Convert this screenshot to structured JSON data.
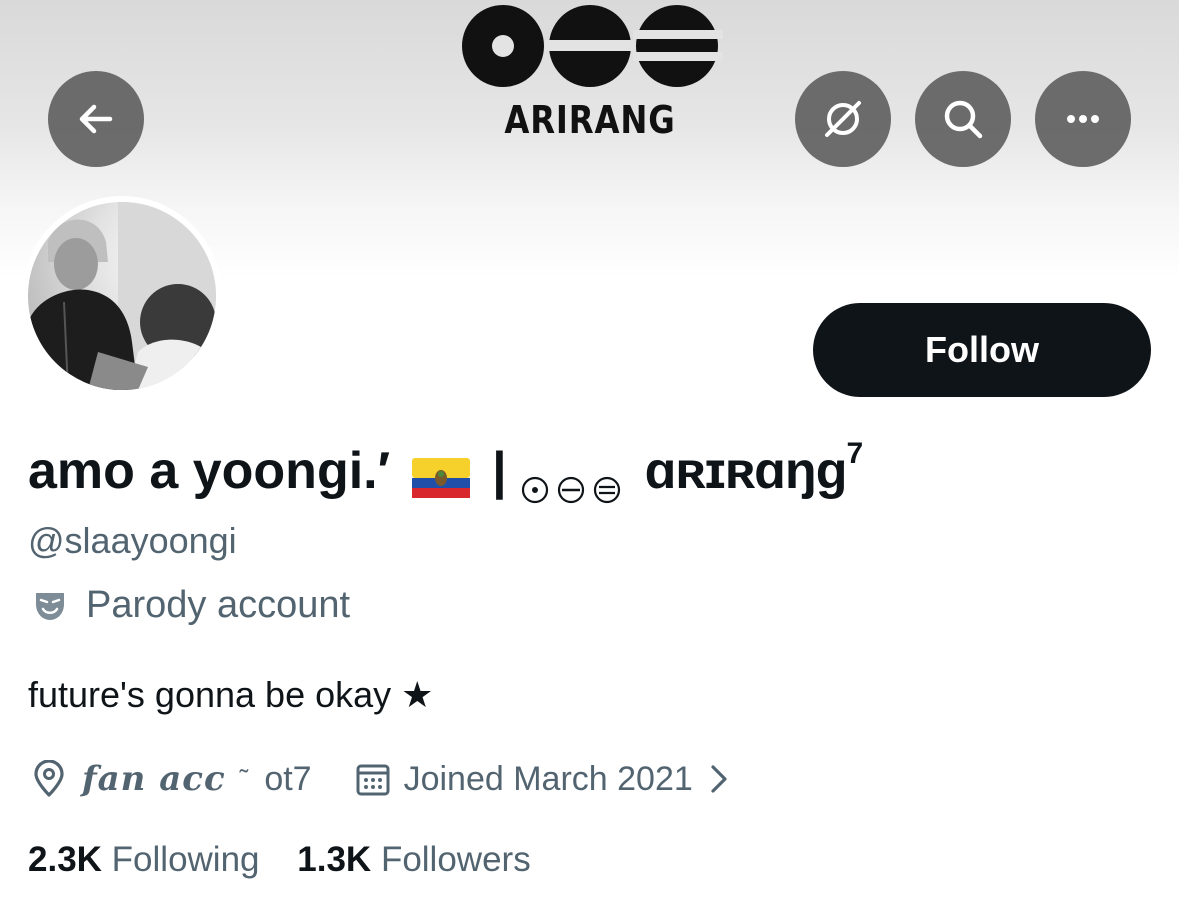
{
  "header": {
    "banner_title": "ARIRANG"
  },
  "toolbar": {
    "back_icon": "arrow-left-icon",
    "grok_icon": "grok-icon",
    "search_icon": "search-icon",
    "more_icon": "more-icon"
  },
  "profile": {
    "follow_label": "Follow",
    "display_name": "amo a yoongi.′",
    "name_separator": "|",
    "name_suffix": "ɑʀɪʀɑŋɡ",
    "name_superscript": "7",
    "handle": "@slaayoongi",
    "parody_label": "Parody account",
    "bio": "future's gonna be okay ★",
    "location_main": "𝒇𝒂𝒏 𝒂𝒄𝒄",
    "location_tilde": "῀",
    "location_rest": "ot7",
    "joined": "Joined March 2021",
    "following_count": "2.3K",
    "following_label": "Following",
    "followers_count": "1.3K",
    "followers_label": "Followers"
  },
  "colors": {
    "primary_text": "#0f1419",
    "secondary_text": "#536471",
    "follow_bg": "#0f1419",
    "overlay_button": "#5a5a5a"
  }
}
